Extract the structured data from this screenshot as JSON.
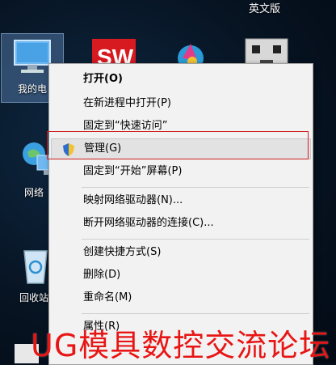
{
  "desktop": {
    "top_label": "英文版",
    "icons": [
      {
        "name": "computer",
        "label": "我的电"
      },
      {
        "name": "network",
        "label": "网络"
      },
      {
        "name": "recycle-bin",
        "label": "回收站"
      }
    ]
  },
  "context_menu": {
    "items": [
      {
        "label": "打开(O)",
        "bold": true
      },
      {
        "label": "在新进程中打开(P)"
      },
      {
        "label": "固定到“快速访问”"
      },
      {
        "label": "管理(G)",
        "highlighted": true
      },
      {
        "label": "固定到“开始”屏幕(P)"
      },
      {
        "label": "映射网络驱动器(N)..."
      },
      {
        "label": "断开网络驱动器的连接(C)..."
      },
      {
        "label": "创建快捷方式(S)"
      },
      {
        "label": "删除(D)"
      },
      {
        "label": "重命名(M)"
      },
      {
        "label": "属性(R)"
      }
    ]
  },
  "watermark": "UG模具数控交流论坛",
  "colors": {
    "highlight_border": "#d02020",
    "watermark": "#e81515"
  }
}
